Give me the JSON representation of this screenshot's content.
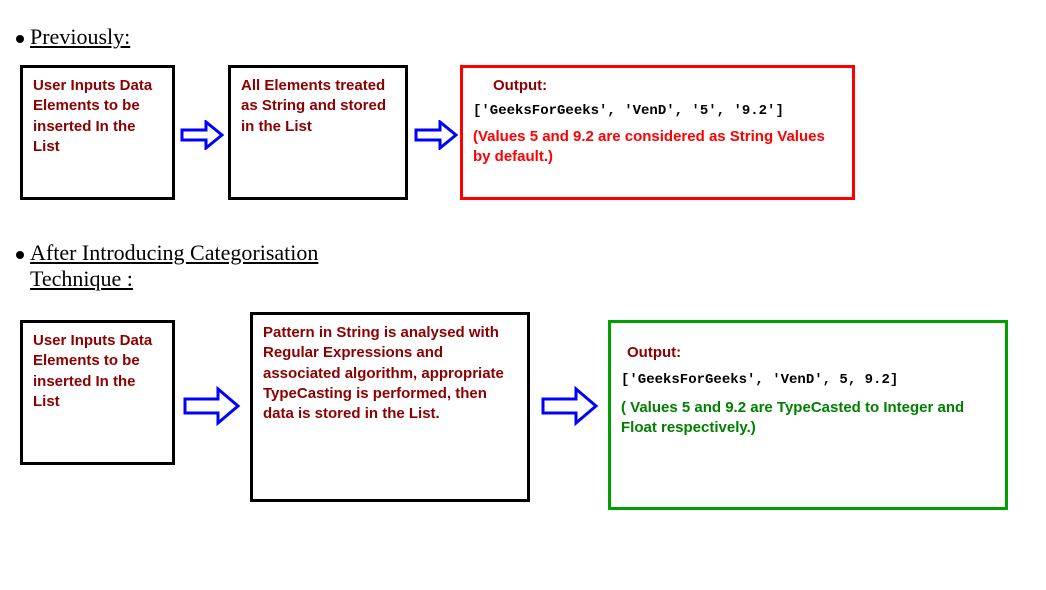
{
  "section1": {
    "heading": "Previously:",
    "box1": "User Inputs Data Elements to be inserted In the List",
    "box2": "All Elements treated as String and stored in the List",
    "output_label": "Output:",
    "output_code": "['GeeksForGeeks', 'VenD', '5', '9.2']",
    "output_note": "(Values 5 and 9.2 are considered as String Values by default.)"
  },
  "section2": {
    "heading_line1": "After Introducing Categorisation",
    "heading_line2": "Technique :",
    "box1": "User Inputs Data Elements to be inserted In the List",
    "box2": "Pattern in String is analysed with Regular Expressions and associated algorithm, appropriate TypeCasting is performed, then data is stored in the List.",
    "output_label": "Output:",
    "output_code": "['GeeksForGeeks', 'VenD', 5, 9.2]",
    "output_note": "( Values  5 and 9.2 are TypeCasted to Integer and Float respectively.)"
  }
}
